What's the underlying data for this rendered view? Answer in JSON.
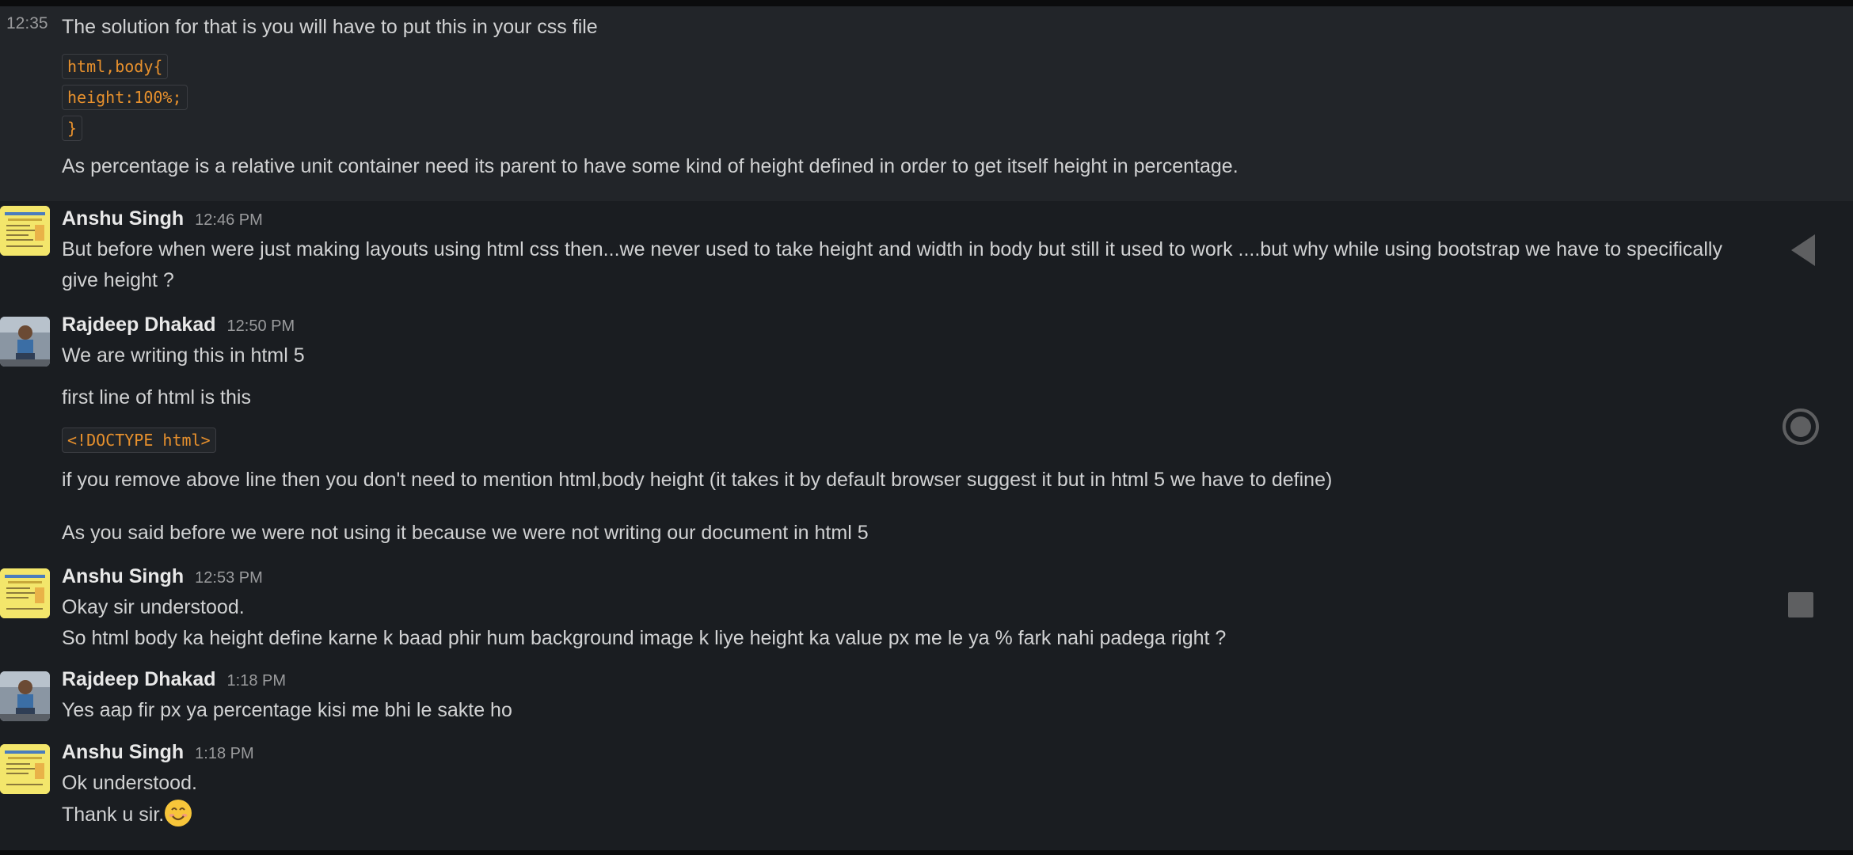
{
  "messages": {
    "m1": {
      "time": "12:35",
      "text": "The solution for that is you will have to put this in your css file",
      "code1": "html,body{",
      "code2": "height:100%;",
      "code3": "}",
      "text2": "As percentage is a relative unit container need its parent to have some kind of height defined in order to get itself height in percentage."
    },
    "m2": {
      "name": "Anshu Singh",
      "time": "12:46 PM",
      "line1": "But before when were just making layouts using html css then...we never used to take height and width in body but still it used to work ....but why while using bootstrap we have to specifically",
      "line2": "give height ?"
    },
    "m3": {
      "name": "Rajdeep Dhakad",
      "time": "12:50 PM",
      "line1": "We are writing this in html 5",
      "line2": "first line of html is this",
      "code": "<!DOCTYPE html>",
      "line3": "if you remove above line then you don't need to mention html,body height (it takes it by default browser suggest it but in html 5 we have to define)",
      "line4": "As you said before we were not using it because we were not writing our document in html 5"
    },
    "m4": {
      "name": "Anshu Singh",
      "time": "12:53 PM",
      "line1": "Okay sir understood.",
      "line2": "So html body ka height define karne k baad phir hum background image k liye height ka value px me le ya %  fark nahi padega right ?"
    },
    "m5": {
      "name": "Rajdeep Dhakad",
      "time": "1:18 PM",
      "line1": "Yes aap fir px ya percentage kisi me bhi le sakte ho"
    },
    "m6": {
      "name": "Anshu Singh",
      "time": "1:18 PM",
      "line1": "Ok understood.",
      "line2": "Thank u sir."
    }
  },
  "icons": {
    "emoji": "smiling-face-icon",
    "nav_back": "back-triangle-icon",
    "nav_home": "home-circle-icon",
    "nav_recent": "recent-square-icon"
  },
  "colors": {
    "background": "#1a1d21",
    "highlight": "#222529",
    "code_text": "#e8912d"
  }
}
